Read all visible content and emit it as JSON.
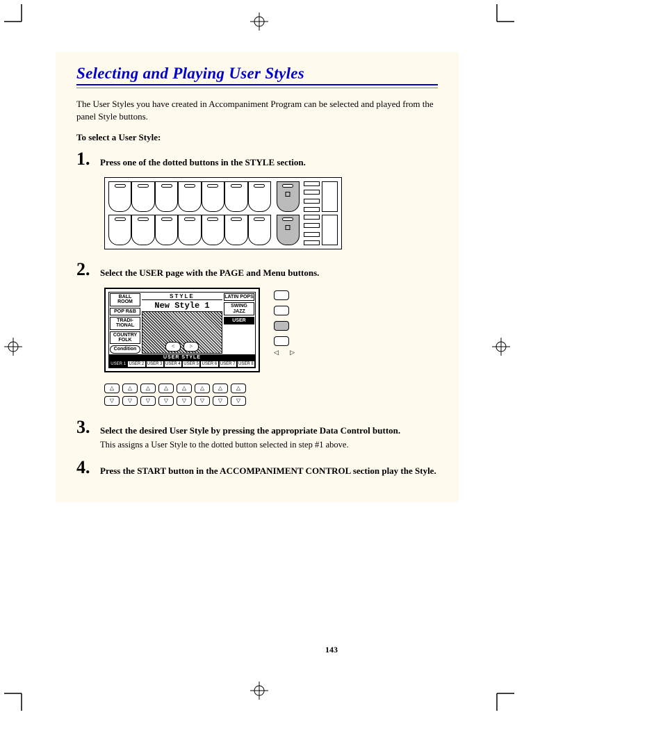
{
  "section_title": "Selecting and Playing User Styles",
  "intro": "The User Styles you have created in Accompaniment Program can be selected and played from the panel Style buttons.",
  "subhead": "To select a User Style:",
  "steps": [
    {
      "num": "1.",
      "title": "Press one of the dotted buttons in the STYLE section."
    },
    {
      "num": "2.",
      "title": "Select the USER page with the PAGE and Menu buttons."
    },
    {
      "num": "3.",
      "title": "Select the desired User Style by pressing the appropriate Data Control button.",
      "note": "This assigns a User Style to the dotted button selected in step #1 above."
    },
    {
      "num": "4.",
      "title": "Press the START button in the ACCOMPANIMENT CONTROL section play the Style."
    }
  ],
  "lcd": {
    "title": "STYLE",
    "style_name": "New Style 1",
    "left": [
      "BALL\nROOM",
      "POP\nR&B",
      "TRADI-\nTIONAL",
      "COUNTRY\nFOLK",
      "Condition"
    ],
    "right": [
      "LATIN\nPOPS",
      "SWING\nJAZZ",
      "USER"
    ],
    "user_bar": "USER STYLE",
    "user_slots": [
      "USER\n1",
      "USER\n2",
      "USER\n3",
      "USER\n4",
      "USER\n5",
      "USER\n6",
      "USER\n7",
      "USER\n8"
    ],
    "page_prev": "<",
    "page_next": ">"
  },
  "side_arrows": {
    "left": "◁",
    "right": "▷"
  },
  "arrow_up": "△",
  "arrow_down": "▽",
  "page_number": "143"
}
